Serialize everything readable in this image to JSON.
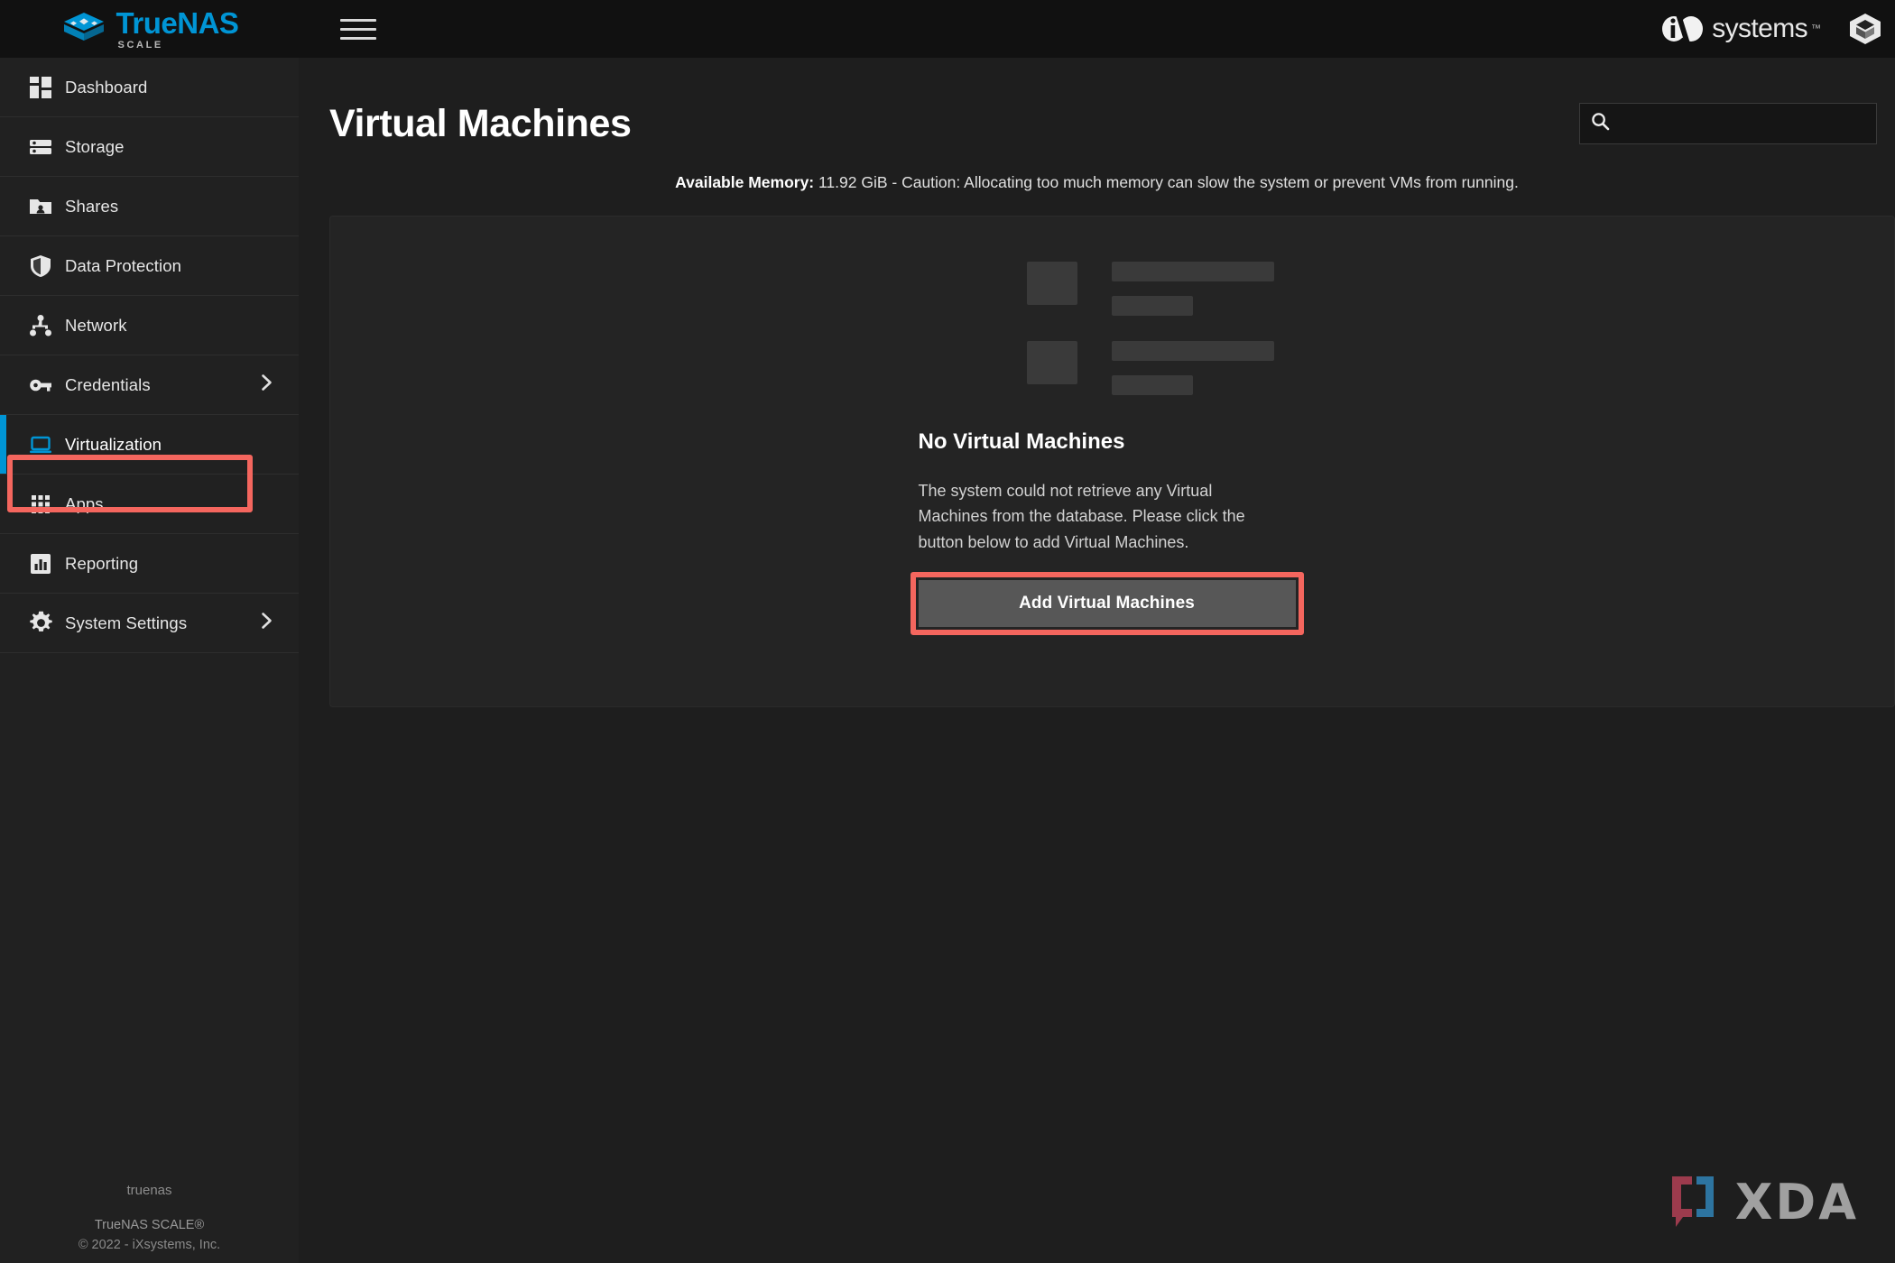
{
  "brand": {
    "logo_true": "True",
    "logo_nas": "NAS",
    "logo_sub": "SCALE",
    "logo_icon": "truenas-cube-logo",
    "accent_blue": "#0095d5",
    "highlight_red": "#f4665e"
  },
  "topbar": {
    "menu_icon": "hamburger-menu-icon",
    "ix_word": "systems",
    "ix_tm": "™",
    "ix_badge_icon": "ix-badge-icon",
    "cube_icon": "cube-icon"
  },
  "sidebar": {
    "items": [
      {
        "label": "Dashboard",
        "icon": "dashboard-icon",
        "active": false,
        "expandable": false
      },
      {
        "label": "Storage",
        "icon": "storage-icon",
        "active": false,
        "expandable": false
      },
      {
        "label": "Shares",
        "icon": "shares-folder-icon",
        "active": false,
        "expandable": false
      },
      {
        "label": "Data Protection",
        "icon": "shield-icon",
        "active": false,
        "expandable": false
      },
      {
        "label": "Network",
        "icon": "network-icon",
        "active": false,
        "expandable": false
      },
      {
        "label": "Credentials",
        "icon": "key-icon",
        "active": false,
        "expandable": true
      },
      {
        "label": "Virtualization",
        "icon": "laptop-icon",
        "active": true,
        "expandable": false
      },
      {
        "label": "Apps",
        "icon": "apps-grid-icon",
        "active": false,
        "expandable": false
      },
      {
        "label": "Reporting",
        "icon": "bar-chart-icon",
        "active": false,
        "expandable": false
      },
      {
        "label": "System Settings",
        "icon": "gear-icon",
        "active": false,
        "expandable": true
      }
    ],
    "chevron_icon": "chevron-right-icon",
    "footer": {
      "hostname": "truenas",
      "product": "TrueNAS SCALE®",
      "copyright": "© 2022 - iXsystems, Inc."
    }
  },
  "main": {
    "page_title": "Virtual Machines",
    "search": {
      "icon": "search-icon",
      "value": "",
      "placeholder": ""
    },
    "memory_notice": {
      "label": "Available Memory:",
      "text": " 11.92 GiB - Caution: Allocating too much memory can slow the system or prevent VMs from running."
    },
    "empty_state": {
      "skeleton_icon": "list-placeholder-skeleton",
      "title": "No Virtual Machines",
      "description": "The system could not retrieve any Virtual Machines from the database. Please click the button below to add Virtual Machines.",
      "button_label": "Add Virtual Machines"
    }
  },
  "watermark": {
    "bracket_icon": "xda-bracket-icon",
    "text": "XDA"
  }
}
